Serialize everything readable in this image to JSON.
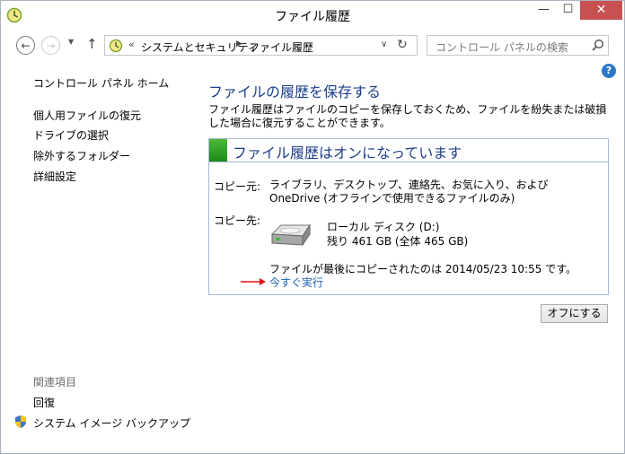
{
  "window": {
    "title": "ファイル履歴",
    "min_glyph": "—",
    "max_glyph": "☐",
    "close_glyph": "✕"
  },
  "nav": {
    "back_glyph": "←",
    "forward_glyph": "→",
    "recent_glyph": "▼",
    "up_glyph": "↑",
    "breadcrumb_chev": "«",
    "breadcrumb": [
      "システムとセキュリティ",
      "ファイル履歴"
    ],
    "breadcrumb_sep": "▶",
    "dropdown_glyph": "∨",
    "refresh_glyph": "↻",
    "search_placeholder": "コントロール パネルの検索"
  },
  "help_glyph": "?",
  "sidebar": {
    "home": "コントロール パネル ホーム",
    "items": [
      "個人用ファイルの復元",
      "ドライブの選択",
      "除外するフォルダー",
      "詳細設定"
    ],
    "related_header": "関連項目",
    "related": [
      "回復",
      "システム イメージ バックアップ"
    ]
  },
  "main": {
    "title": "ファイルの履歴を保存する",
    "description": "ファイル履歴はファイルのコピーを保存しておくため、ファイルを紛失または破損した場合に復元することができます。",
    "status_title": "ファイル履歴はオンになっています",
    "copy_from_label": "コピー元:",
    "copy_from_value": "ライブラリ、デスクトップ、連絡先、お気に入り、および OneDrive (オフラインで使用できるファイルのみ)",
    "copy_to_label": "コピー先:",
    "drive_name": "ローカル ディスク (D:)",
    "drive_space": "残り 461 GB (全体 465 GB)",
    "last_copy": "ファイルが最後にコピーされたのは 2014/05/23 10:55 です。",
    "run_now": "今すぐ実行",
    "off_button": "オフにする"
  },
  "colors": {
    "heading": "#1e3f8a",
    "link": "#1a5fb4",
    "status_green": "#2a9a23",
    "close_red": "#c75050",
    "arrow_red": "#e01010"
  }
}
